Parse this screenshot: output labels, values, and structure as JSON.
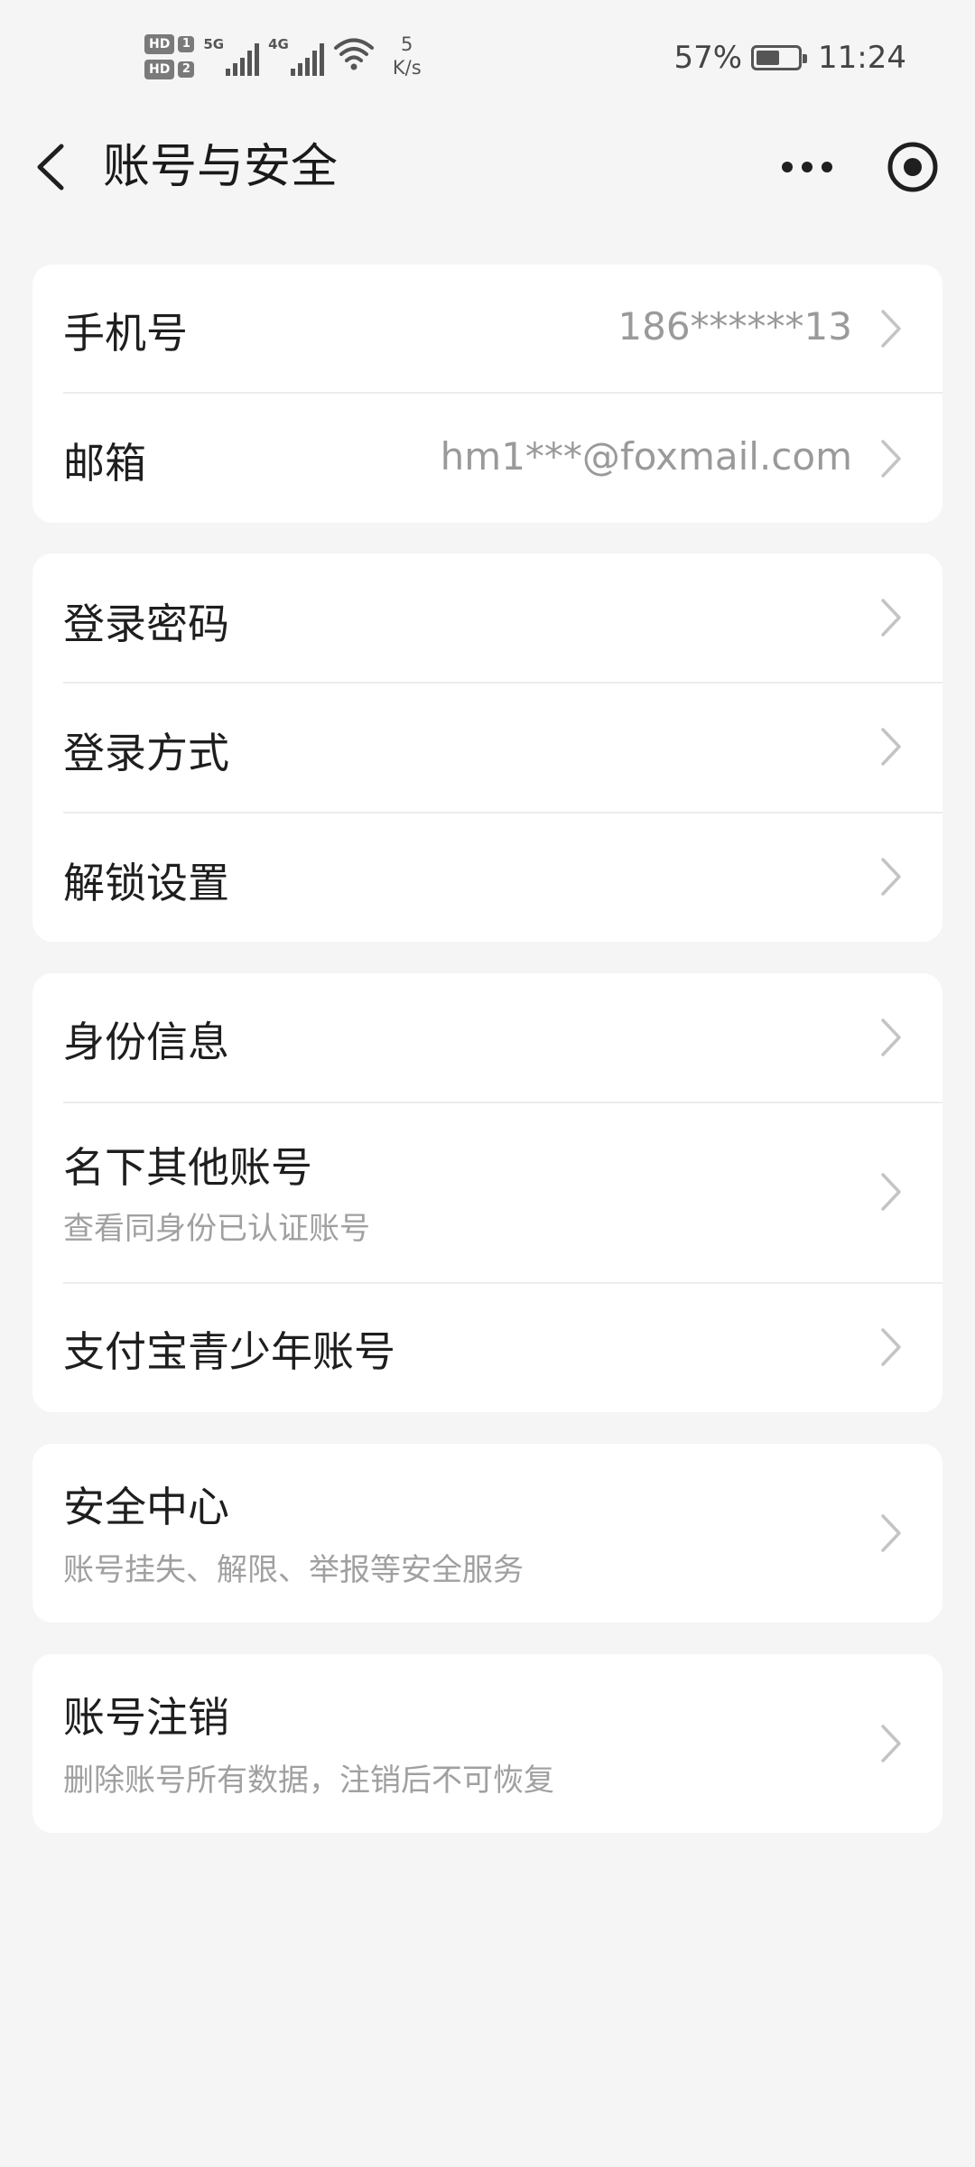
{
  "status_bar": {
    "hd1": "HD",
    "hd1_num": "1",
    "hd2": "HD",
    "hd2_num": "2",
    "net1": "5G",
    "net2": "4G",
    "speed_value": "5",
    "speed_unit": "K/s",
    "battery_percent": "57%",
    "battery_level": 0.57,
    "time": "11:24"
  },
  "header": {
    "title": "账号与安全",
    "back_icon": "chevron-left-icon",
    "more_icon": "more-horizontal-icon",
    "mini_program_icon": "target-icon"
  },
  "account": {
    "phone_label": "手机号",
    "phone_value": "186******13",
    "email_label": "邮箱",
    "email_value": "hm1***@foxmail.com"
  },
  "login": {
    "password_label": "登录密码",
    "method_label": "登录方式",
    "unlock_label": "解锁设置"
  },
  "identity": {
    "info_label": "身份信息",
    "other_accounts_label": "名下其他账号",
    "other_accounts_sub": "查看同身份已认证账号",
    "teen_label": "支付宝青少年账号"
  },
  "security": {
    "center_label": "安全中心",
    "center_sub": "账号挂失、解限、举报等安全服务"
  },
  "deactivate": {
    "label": "账号注销",
    "sub": "删除账号所有数据，注销后不可恢复"
  },
  "colors": {
    "background": "#f5f5f5",
    "card": "#ffffff",
    "primary_text": "#1e1e1e",
    "secondary_text": "#9a9a9a",
    "divider": "#ececec"
  }
}
